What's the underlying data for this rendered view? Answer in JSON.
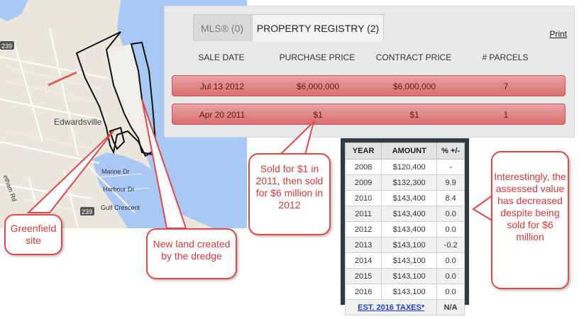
{
  "map": {
    "place_label": "Edwardsville",
    "road_badges": [
      "239",
      "239"
    ],
    "street_labels": [
      "Marine Dr",
      "Harbour Dr",
      "Gulf Crescent",
      "etham Rd"
    ]
  },
  "registry": {
    "tabs": [
      {
        "label": "MLS® (0)",
        "active": false
      },
      {
        "label": "PROPERTY REGISTRY (2)",
        "active": true
      }
    ],
    "print_label": "Print",
    "columns": [
      "SALE DATE",
      "PURCHASE PRICE",
      "CONTRACT PRICE",
      "# PARCELS"
    ],
    "rows": [
      {
        "sale_date": "Jul 13 2012",
        "purchase_price": "$6,000,000",
        "contract_price": "$6,000,000",
        "parcels": "7"
      },
      {
        "sale_date": "Apr 20 2011",
        "purchase_price": "$1",
        "contract_price": "$1",
        "parcels": "1"
      }
    ]
  },
  "assessment": {
    "headers": [
      "YEAR",
      "AMOUNT",
      "% +/-"
    ],
    "rows": [
      {
        "year": "2008",
        "amount": "$120,400",
        "change": "-"
      },
      {
        "year": "2009",
        "amount": "$132,300",
        "change": "9.9"
      },
      {
        "year": "2010",
        "amount": "$143,400",
        "change": "8.4"
      },
      {
        "year": "2011",
        "amount": "$143,400",
        "change": "0.0"
      },
      {
        "year": "2012",
        "amount": "$143,400",
        "change": "0.0"
      },
      {
        "year": "2013",
        "amount": "$143,100",
        "change": "-0.2"
      },
      {
        "year": "2014",
        "amount": "$143,100",
        "change": "0.0"
      },
      {
        "year": "2015",
        "amount": "$143,100",
        "change": "0.0"
      },
      {
        "year": "2016",
        "amount": "$143,100",
        "change": "0.0"
      }
    ],
    "taxes_link": "EST. 2016 TAXES*",
    "taxes_value": "N/A"
  },
  "callouts": {
    "greenfield": "Greenfield site",
    "new_land": "New land created by the dredge",
    "sold": "Sold for $1 in 2011, then sold for $6 million in 2012",
    "interesting": "Interestingly, the assessed value has decreased despite being sold for $6 million"
  },
  "colors": {
    "callout_red": "#e04848",
    "row_red": "#d96d6d",
    "water": "#a9c8f3",
    "land": "#ece7dd"
  }
}
